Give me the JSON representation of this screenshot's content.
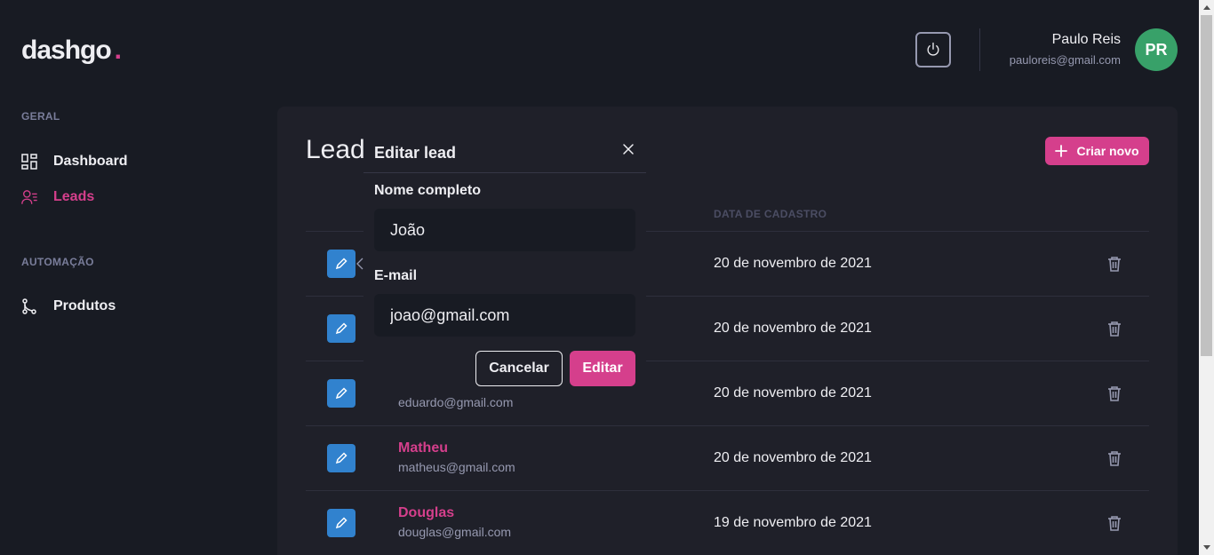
{
  "logo": {
    "text": "dashgo",
    "dot": "."
  },
  "header": {
    "user_name": "Paulo Reis",
    "user_email": "pauloreis@gmail.com",
    "avatar_initials": "PR"
  },
  "sidebar": {
    "sections": [
      {
        "title": "GERAL",
        "items": [
          {
            "label": "Dashboard",
            "icon": "dashboard-icon"
          },
          {
            "label": "Leads",
            "icon": "users-icon",
            "active": true
          }
        ]
      },
      {
        "title": "AUTOMAÇÃO",
        "items": [
          {
            "label": "Produtos",
            "icon": "git-branch-icon"
          }
        ]
      }
    ]
  },
  "main": {
    "title": "Lead",
    "create_label": "Criar novo",
    "column_date": "DATA DE CADASTRO",
    "rows": [
      {
        "name": "",
        "email": "",
        "date": "20 de novembro de 2021"
      },
      {
        "name": "",
        "email": "",
        "date": "20 de novembro de 2021"
      },
      {
        "name": "",
        "email": "eduardo@gmail.com",
        "date": "20 de novembro de 2021"
      },
      {
        "name": "Matheu",
        "email": "matheus@gmail.com",
        "date": "20 de novembro de 2021"
      },
      {
        "name": "Douglas",
        "email": "douglas@gmail.com",
        "date": "19 de novembro de 2021"
      }
    ]
  },
  "modal": {
    "title": "Editar lead",
    "name_label": "Nome completo",
    "name_value": "João",
    "email_label": "E-mail",
    "email_value": "joao@gmail.com",
    "cancel_label": "Cancelar",
    "submit_label": "Editar"
  },
  "colors": {
    "accent": "#d53f8c",
    "blue": "#3182ce",
    "background": "#181b23",
    "card": "#1f2029",
    "avatar": "#38a169"
  }
}
